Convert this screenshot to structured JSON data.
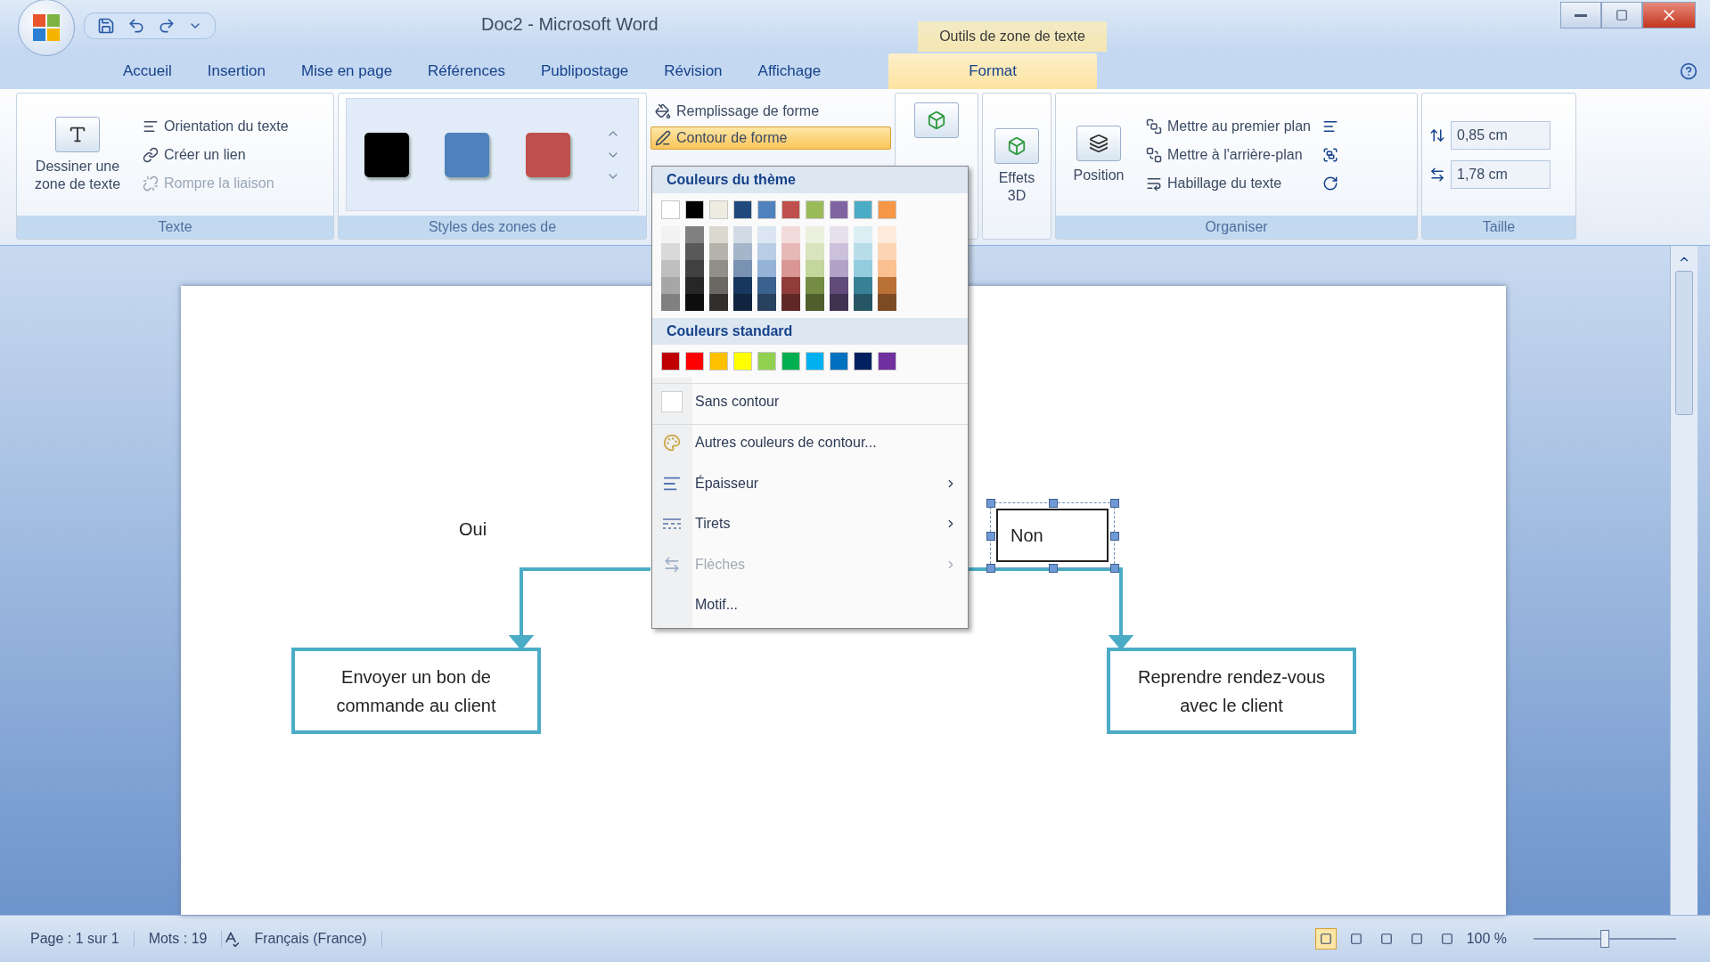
{
  "window": {
    "title": "Doc2 - Microsoft Word",
    "context_group": "Outils de zone de texte"
  },
  "tabs": [
    {
      "label": "Accueil",
      "selected": false
    },
    {
      "label": "Insertion",
      "selected": false
    },
    {
      "label": "Mise en page",
      "selected": false
    },
    {
      "label": "Références",
      "selected": false
    },
    {
      "label": "Publipostage",
      "selected": false
    },
    {
      "label": "Révision",
      "selected": false
    },
    {
      "label": "Affichage",
      "selected": false
    },
    {
      "label": "Format",
      "selected": true,
      "kind": "context"
    }
  ],
  "text_group": {
    "label": "Texte",
    "big_button": "Dessiner une zone de texte",
    "items": [
      {
        "label": "Orientation du texte",
        "disabled": false
      },
      {
        "label": "Créer un lien",
        "disabled": false
      },
      {
        "label": "Rompre la liaison",
        "disabled": true
      }
    ]
  },
  "styles_group": {
    "label": "Styles des zones de",
    "swatches": [
      {
        "color": "#000000"
      },
      {
        "color": "#4f81bd"
      },
      {
        "color": "#c0504d"
      }
    ]
  },
  "shape_buttons": [
    {
      "label": "Remplissage de forme",
      "selected": false
    },
    {
      "label": "Contour de forme",
      "selected": true
    }
  ],
  "effects_3d": {
    "label": "Effets 3D"
  },
  "arrange_group": {
    "label": "Organiser",
    "position": "Position",
    "items": [
      "Mettre au premier plan",
      "Mettre à l'arrière-plan",
      "Habillage du texte"
    ]
  },
  "size_group": {
    "label": "Taille",
    "fields": [
      {
        "value": "0,85 cm"
      },
      {
        "value": "1,78 cm"
      }
    ]
  },
  "dropdown": {
    "theme_heading": "Couleurs du thème",
    "theme_colors": [
      {
        "color": "#ffffff"
      },
      {
        "color": "#000000"
      },
      {
        "color": "#eeece1"
      },
      {
        "color": "#1f497d"
      },
      {
        "color": "#4f81bd"
      },
      {
        "color": "#c0504d"
      },
      {
        "color": "#9bbb59"
      },
      {
        "color": "#8064a2"
      },
      {
        "color": "#4bacc6"
      },
      {
        "color": "#f79646"
      }
    ],
    "standard_heading": "Couleurs standard",
    "standard_colors": [
      {
        "color": "#c00000"
      },
      {
        "color": "#ff0000"
      },
      {
        "color": "#ffc000"
      },
      {
        "color": "#ffff00"
      },
      {
        "color": "#92d050"
      },
      {
        "color": "#00b050"
      },
      {
        "color": "#00b0f0"
      },
      {
        "color": "#0070c0"
      },
      {
        "color": "#002060"
      },
      {
        "color": "#7030a0"
      }
    ],
    "items": [
      {
        "label": "Sans contour",
        "kind": "none",
        "disabled": false
      },
      {
        "label": "Autres couleurs de contour...",
        "kind": "palette",
        "disabled": false
      },
      {
        "label": "Épaisseur",
        "kind": "weight",
        "disabled": false
      },
      {
        "label": "Tirets",
        "kind": "dashes",
        "disabled": false
      },
      {
        "label": "Flèches",
        "kind": "arrows",
        "disabled": true
      },
      {
        "label": "Motif...",
        "kind": "plain",
        "disabled": false
      }
    ]
  },
  "diagram": {
    "yes_label": "Oui",
    "no_box": {
      "text": "Non",
      "selected": true
    },
    "boxes": [
      {
        "text": "Envoyer un bon de commande au client"
      },
      {
        "text": "Reprendre rendez-vous avec le client"
      }
    ]
  },
  "status_bar": {
    "items": [
      "Page : 1 sur 1",
      "Mots : 19",
      "Français (France)"
    ],
    "zoom": {
      "label": "100 %",
      "level": 0.5
    }
  }
}
